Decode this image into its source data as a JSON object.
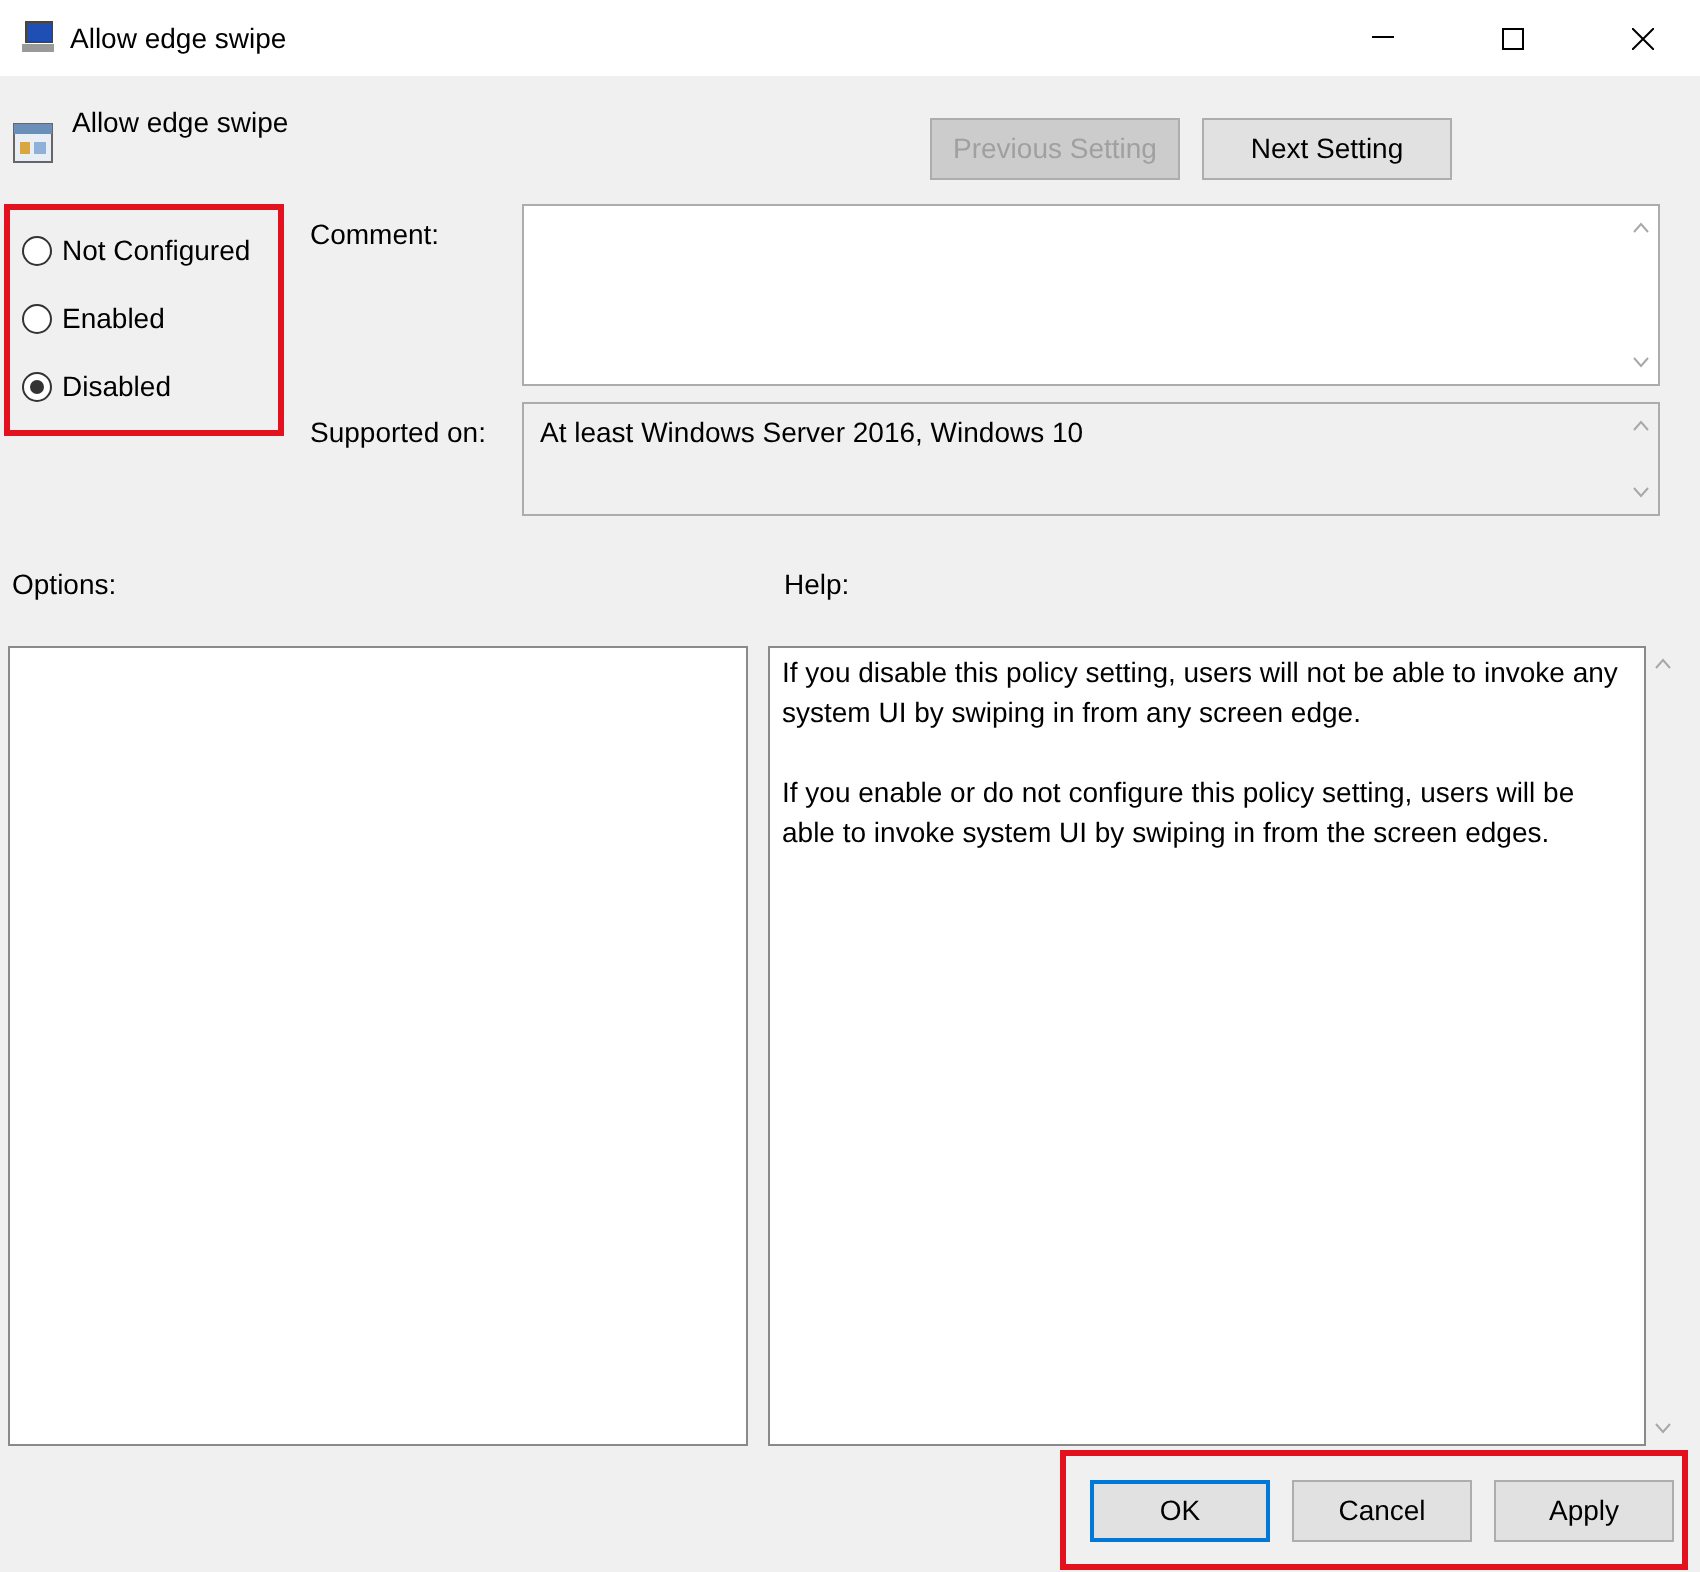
{
  "window": {
    "title": "Allow edge swipe"
  },
  "policy": {
    "name": "Allow edge swipe"
  },
  "nav_buttons": [
    {
      "label": "Previous Setting",
      "disabled": true
    },
    {
      "label": "Next Setting",
      "disabled": false
    }
  ],
  "states": [
    {
      "label": "Not Configured",
      "selected": false
    },
    {
      "label": "Enabled",
      "selected": false
    },
    {
      "label": "Disabled",
      "selected": true
    }
  ],
  "comment": {
    "label": "Comment:"
  },
  "supported_on": {
    "label": "Supported on:",
    "value": "At least Windows Server 2016, Windows 10"
  },
  "options": {
    "label": "Options:"
  },
  "help": {
    "label": "Help:",
    "paragraphs": [
      "If you disable this policy setting, users will not be able to invoke any system UI by swiping in from any screen edge.",
      "If you enable or do not configure this policy setting, users will be able to invoke system UI by swiping in from the screen edges."
    ]
  },
  "buttons": [
    {
      "label": "OK",
      "default": true
    },
    {
      "label": "Cancel",
      "default": false
    },
    {
      "label": "Apply",
      "default": false
    }
  ]
}
